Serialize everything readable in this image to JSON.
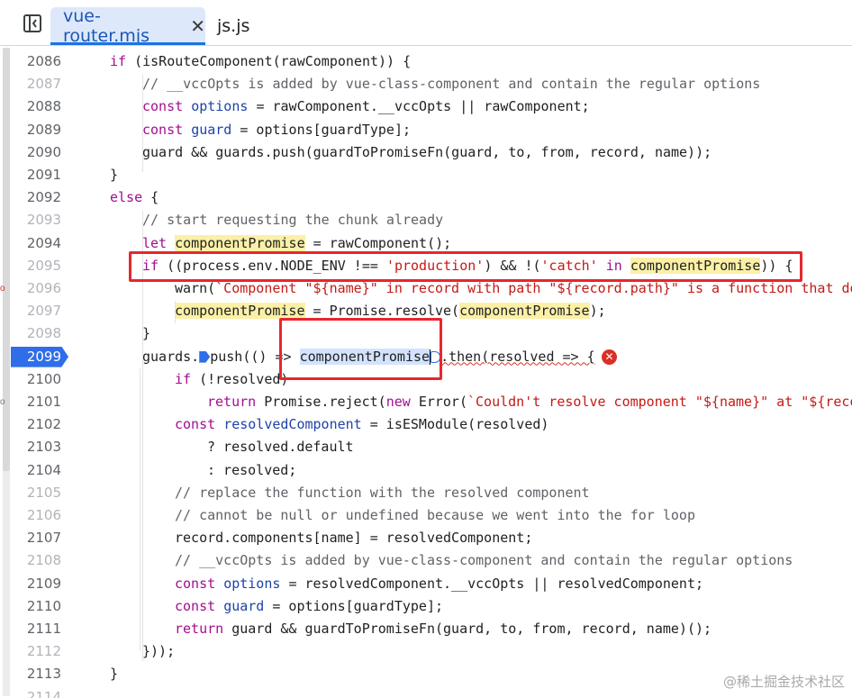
{
  "tabs": [
    {
      "label": "vue-router.mjs",
      "active": true
    },
    {
      "label": "js.js",
      "active": false
    }
  ],
  "icons": {
    "sidebar_toggle": "sidebar-toggle-icon",
    "close": "close-icon",
    "error": "error-icon",
    "breakpoint": "breakpoint-icon"
  },
  "colors": {
    "accent": "#1a73e8",
    "keyword": "#a30d8f",
    "string": "#c41a16",
    "highlight": "#fbf0a6",
    "annotation": "#e8262d"
  },
  "lines": [
    {
      "no": "2086",
      "segs": [
        [
          "kw",
          "if"
        ],
        [
          "",
          "(isRouteComponent(rawComponent)) {"
        ]
      ]
    },
    {
      "no": "2087",
      "segs": [
        [
          "cm",
          "// __vccOpts is added by vue-class-component and contain the regular options"
        ]
      ]
    },
    {
      "no": "2088",
      "segs": [
        [
          "kw",
          "const"
        ],
        [
          "var",
          "options"
        ],
        [
          "",
          "= rawComponent.__vccOpts || rawComponent;"
        ]
      ]
    },
    {
      "no": "2089",
      "segs": [
        [
          "kw",
          "const"
        ],
        [
          "var",
          "guard"
        ],
        [
          "",
          "= options[guardType];"
        ]
      ]
    },
    {
      "no": "2090",
      "segs": [
        [
          "",
          "guard && guards.push(guardToPromiseFn(guard, to, from, record, name));"
        ]
      ]
    },
    {
      "no": "2091",
      "segs": [
        [
          "",
          "}"
        ]
      ]
    },
    {
      "no": "2092",
      "segs": [
        [
          "kw",
          "else"
        ],
        [
          "",
          "{"
        ]
      ]
    },
    {
      "no": "2093",
      "segs": [
        [
          "cm",
          "// start requesting the chunk already"
        ]
      ]
    },
    {
      "no": "2094",
      "segs": [
        [
          "kw",
          "let"
        ],
        [
          "hl",
          "componentPromise"
        ],
        [
          "",
          "= rawComponent();"
        ]
      ]
    },
    {
      "no": "2095",
      "segs": [
        [
          "kw",
          "if"
        ],
        [
          "",
          "((process.env.NODE_ENV !=="
        ],
        [
          "str",
          "'production'"
        ],
        [
          "",
          ") && !("
        ],
        [
          "str",
          "'catch'"
        ],
        [
          "kw",
          "in"
        ],
        [
          "hl",
          "componentPromise"
        ],
        [
          "",
          ")) {"
        ]
      ]
    },
    {
      "no": "2096",
      "segs": [
        [
          "",
          "warn("
        ],
        [
          "str",
          "`Component \"${name}\" in record with path \"${record.path}\" is a function that do"
        ]
      ]
    },
    {
      "no": "2097",
      "segs": [
        [
          "hl",
          "componentPromise"
        ],
        [
          "",
          "= Promise.resolve("
        ],
        [
          "hl",
          "componentPromise"
        ],
        [
          "",
          ");"
        ]
      ]
    },
    {
      "no": "2098",
      "segs": [
        [
          "",
          "}"
        ]
      ]
    },
    {
      "no": "2099",
      "segs": [
        [
          "",
          "guards."
        ],
        [
          "",
          "push(() =>"
        ],
        [
          "sel",
          "componentPromise"
        ],
        [
          "",
          ".then(resolved => {"
        ]
      ]
    },
    {
      "no": "2100",
      "segs": [
        [
          "kw",
          "if"
        ],
        [
          "",
          "(!resolved)"
        ]
      ]
    },
    {
      "no": "2101",
      "segs": [
        [
          "kw",
          "return"
        ],
        [
          "",
          "Promise.reject("
        ],
        [
          "kw",
          "new"
        ],
        [
          "",
          "Error("
        ],
        [
          "str",
          "`Couldn't resolve component \"${name}\" at \"${reco"
        ]
      ]
    },
    {
      "no": "2102",
      "segs": [
        [
          "kw",
          "const"
        ],
        [
          "var",
          "resolvedComponent"
        ],
        [
          "",
          "= isESModule(resolved)"
        ]
      ]
    },
    {
      "no": "2103",
      "segs": [
        [
          "",
          "? resolved.default"
        ]
      ]
    },
    {
      "no": "2104",
      "segs": [
        [
          "",
          ": resolved;"
        ]
      ]
    },
    {
      "no": "2105",
      "segs": [
        [
          "cm",
          "// replace the function with the resolved component"
        ]
      ]
    },
    {
      "no": "2106",
      "segs": [
        [
          "cm",
          "// cannot be null or undefined because we went into the for loop"
        ]
      ]
    },
    {
      "no": "2107",
      "segs": [
        [
          "",
          "record.components[name] = resolvedComponent;"
        ]
      ]
    },
    {
      "no": "2108",
      "segs": [
        [
          "cm",
          "// __vccOpts is added by vue-class-component and contain the regular options"
        ]
      ]
    },
    {
      "no": "2109",
      "segs": [
        [
          "kw",
          "const"
        ],
        [
          "var",
          "options"
        ],
        [
          "",
          "= resolvedComponent.__vccOpts || resolvedComponent;"
        ]
      ]
    },
    {
      "no": "2110",
      "segs": [
        [
          "kw",
          "const"
        ],
        [
          "var",
          "guard"
        ],
        [
          "",
          "= options[guardType];"
        ]
      ]
    },
    {
      "no": "2111",
      "segs": [
        [
          "kw",
          "return"
        ],
        [
          "",
          "guard && guardToPromiseFn(guard, to, from, record, name)();"
        ]
      ]
    },
    {
      "no": "2112",
      "segs": [
        [
          "",
          "}));"
        ]
      ]
    },
    {
      "no": "2113",
      "segs": [
        [
          "",
          "}"
        ]
      ]
    },
    {
      "no": "2114",
      "segs": [
        [
          "",
          ""
        ]
      ]
    }
  ],
  "current_line": "2099",
  "watermark": "@稀土掘金技术社区"
}
